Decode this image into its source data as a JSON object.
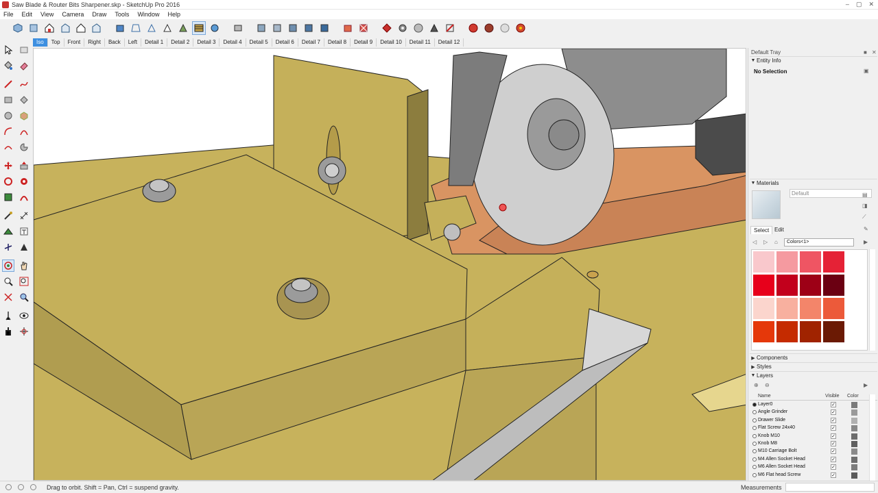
{
  "window": {
    "title": "Saw Blade & Router Bits Sharpener.skp - SketchUp Pro 2016",
    "controls": [
      "–",
      "▢",
      "✕"
    ]
  },
  "menu": [
    "File",
    "Edit",
    "View",
    "Camera",
    "Draw",
    "Tools",
    "Window",
    "Help"
  ],
  "scenes": [
    "Iso",
    "Top",
    "Front",
    "Right",
    "Back",
    "Left",
    "Detail 1",
    "Detail 2",
    "Detail 3",
    "Detail 4",
    "Detail 5",
    "Detail 6",
    "Detail 7",
    "Detail 8",
    "Detail 9",
    "Detail 10",
    "Detail 11",
    "Detail 12"
  ],
  "active_scene": "Iso",
  "tray": {
    "title": "Default Tray",
    "entity_info": {
      "label": "Entity Info",
      "selection": "No Selection"
    },
    "materials": {
      "label": "Materials",
      "name_placeholder": "Default",
      "tabs": [
        "Select",
        "Edit"
      ],
      "library": "Colors<1>",
      "swatch_colors": [
        "#f9c8cc",
        "#f59aa0",
        "#ef5563",
        "#e52236",
        "#e7001b",
        "#c2001c",
        "#9d0016",
        "#6b0012",
        "#fbd5cd",
        "#f8b09f",
        "#f3856a",
        "#ec5a3a",
        "#e5380a",
        "#c52b00",
        "#a02300",
        "#6b1a04"
      ]
    },
    "components": {
      "label": "Components"
    },
    "styles": {
      "label": "Styles"
    },
    "layers": {
      "label": "Layers",
      "columns": {
        "name": "Name",
        "visible": "Visible",
        "color": "Color"
      },
      "items": [
        {
          "name": "Layer0",
          "active": true,
          "color": "#7a7a7a"
        },
        {
          "name": "Angle Grinder",
          "active": false,
          "color": "#9a9a9a"
        },
        {
          "name": "Drawer Slide",
          "active": false,
          "color": "#b0b0b0"
        },
        {
          "name": "Flat Screw 24x40",
          "active": false,
          "color": "#888888"
        },
        {
          "name": "Knob M10",
          "active": false,
          "color": "#6c6c6c"
        },
        {
          "name": "Knob M8",
          "active": false,
          "color": "#5e5e5e"
        },
        {
          "name": "M10 Carriage Bolt",
          "active": false,
          "color": "#8a8a8a"
        },
        {
          "name": "M4 Allen Socket Head",
          "active": false,
          "color": "#6e6e6e"
        },
        {
          "name": "M6 Allen Socket Head",
          "active": false,
          "color": "#7d7d7d"
        },
        {
          "name": "M6 Flat head Screw",
          "active": false,
          "color": "#5a5a5a"
        }
      ]
    }
  },
  "status": {
    "hint": "Drag to orbit. Shift = Pan, Ctrl = suspend gravity.",
    "measurements_label": "Measurements"
  },
  "colors": {
    "wood_top": "#c5b05a",
    "wood_front": "#b9a556",
    "wood_side": "#8c7d3e",
    "copper": "#d99462",
    "copper_dark": "#b5734a",
    "disc": "#c7c7c7",
    "accent": "#3d8fe0"
  }
}
